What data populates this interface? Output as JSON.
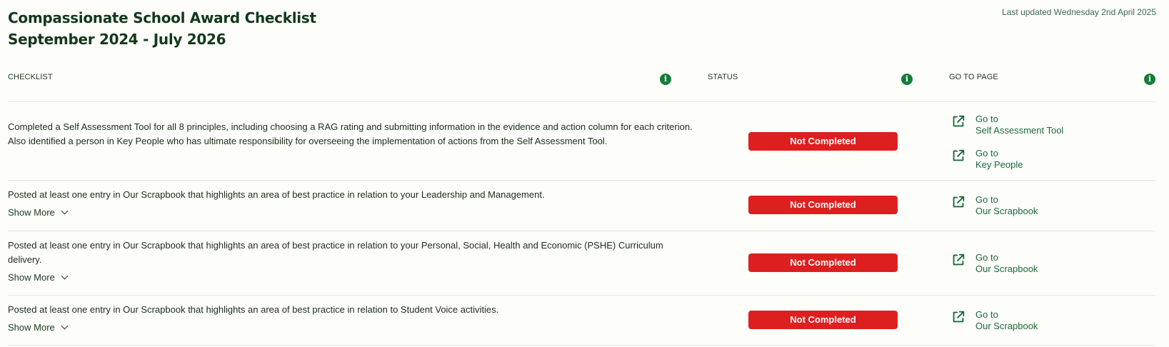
{
  "header": {
    "title_line1": "Compassionate School Award Checklist",
    "title_line2": "September 2024 - July 2026",
    "last_updated": "Last updated Wednesday 2nd April 2025"
  },
  "columns": {
    "checklist": "CHECKLIST",
    "status": "STATUS",
    "goto": "GO TO PAGE"
  },
  "colors": {
    "badge_red": "#de1f1f",
    "info_green": "#137d3a",
    "link_green": "#1a6a38"
  },
  "rows": [
    {
      "description": "Completed a Self Assessment Tool for all 8 principles, including choosing a RAG rating and submitting information in the evidence and action column for each criterion. Also identified a person in Key People who has ultimate responsibility for overseeing the implementation of actions from the Self Assessment Tool.",
      "status": "Not Completed",
      "links": [
        {
          "prefix": "Go to",
          "target": "Self Assessment Tool"
        },
        {
          "prefix": "Go to",
          "target": "Key People"
        }
      ]
    },
    {
      "description": "Posted at least one entry in Our Scrapbook that highlights an area of best practice in relation to your Leadership and Management.",
      "show_more": "Show More",
      "status": "Not Completed",
      "links": [
        {
          "prefix": "Go to",
          "target": "Our Scrapbook"
        }
      ]
    },
    {
      "description": "Posted at least one entry in Our Scrapbook that highlights an area of best practice in relation to your Personal, Social, Health and Economic (PSHE) Curriculum delivery.",
      "show_more": "Show More",
      "status": "Not Completed",
      "links": [
        {
          "prefix": "Go to",
          "target": "Our Scrapbook"
        }
      ]
    },
    {
      "description": "Posted at least one entry in Our Scrapbook that highlights an area of best practice in relation to Student Voice activities.",
      "show_more": "Show More",
      "status": "Not Completed",
      "links": [
        {
          "prefix": "Go to",
          "target": "Our Scrapbook"
        }
      ]
    }
  ]
}
